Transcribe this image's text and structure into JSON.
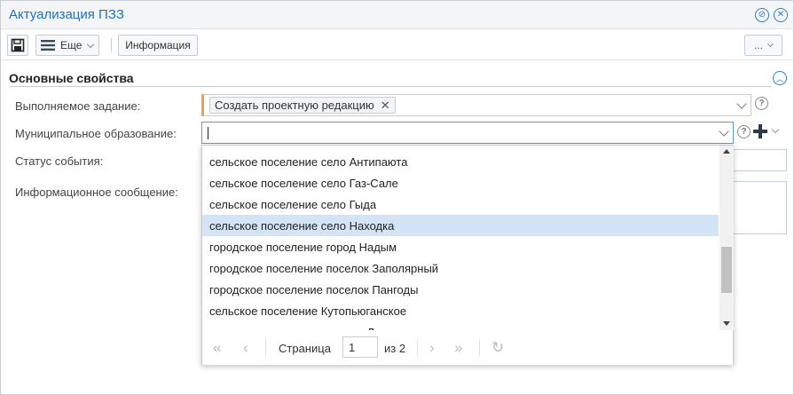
{
  "window": {
    "title": "Актуализация ПЗЗ"
  },
  "toolbar": {
    "more_label": "Еще",
    "info_label": "Информация",
    "overflow_label": "..."
  },
  "section": {
    "title": "Основные свойства"
  },
  "form": {
    "task_label": "Выполняемое задание:",
    "task_value": "Создать проектную редакцию",
    "municipality_label": "Муниципальное образование:",
    "municipality_value": "",
    "event_status_label": "Статус события:",
    "info_message_label": "Информационное сообщение:"
  },
  "dropdown": {
    "items": [
      {
        "label": "сельское поселение село Антипаюта",
        "selected": false
      },
      {
        "label": "сельское поселение село Газ-Сале",
        "selected": false
      },
      {
        "label": "сельское поселение село Гыда",
        "selected": false
      },
      {
        "label": "сельское поселение село Находка",
        "selected": true
      },
      {
        "label": "городское поселение город Надым",
        "selected": false
      },
      {
        "label": "городское поселение поселок Заполярный",
        "selected": false
      },
      {
        "label": "городское поселение поселок Пангоды",
        "selected": false
      },
      {
        "label": "сельское поселение Кутопьюганское",
        "selected": false
      },
      {
        "label": "сельское поселение поселок Лонгъюган",
        "selected": false
      }
    ],
    "pager": {
      "page_label": "Страница",
      "current_page": "1",
      "total_label": "из 2"
    }
  },
  "colors": {
    "accent": "#1a73c4",
    "selected_row": "#d3e4f4",
    "required_marker": "#e8a33c"
  }
}
